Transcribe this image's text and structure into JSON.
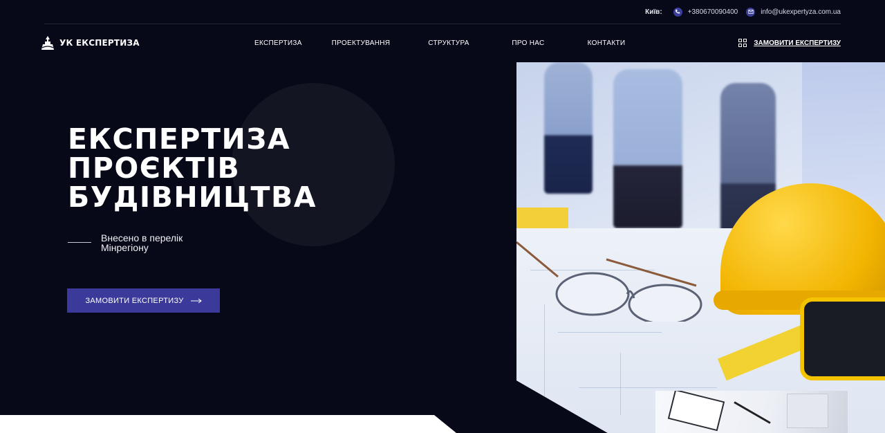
{
  "topbar": {
    "city": "Київ:",
    "phone": "+380670090400",
    "email": "info@ukexpertyza.com.ua"
  },
  "header": {
    "logo_text": "УК ЕКСПЕРТИЗА",
    "nav": [
      {
        "label": "ЕКСПЕРТИЗА"
      },
      {
        "label": "ПРОЕКТУВАННЯ"
      },
      {
        "label": "СТРУКТУРА"
      },
      {
        "label": "ПРО НАС"
      },
      {
        "label": "КОНТАКТИ"
      }
    ],
    "order_label": "ЗАМОВИТИ ЕКСПЕРТИЗУ"
  },
  "hero": {
    "title": "ЕКСПЕРТИЗА\nПРОЄКТІВ\nБУДІВНИЦТВА",
    "subtitle": "Внесено в перелік\nМінрегіону",
    "cta_label": "ЗАМОВИТИ ЕКСПЕРТИЗУ"
  },
  "colors": {
    "background": "#070818",
    "accent": "#3b3a9a",
    "circle": "#141522"
  }
}
